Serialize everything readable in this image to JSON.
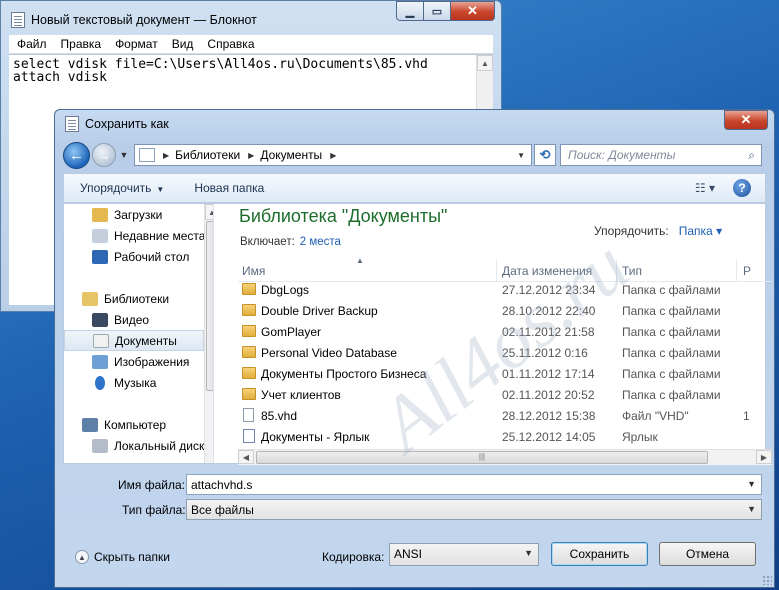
{
  "notepad": {
    "title": "Новый текстовый документ — Блокнот",
    "menu": [
      "Файл",
      "Правка",
      "Формат",
      "Вид",
      "Справка"
    ],
    "lines": [
      "select vdisk file=C:\\Users\\All4os.ru\\Documents\\85.vhd",
      "attach vdisk"
    ]
  },
  "dialog": {
    "title": "Сохранить как",
    "address": [
      "Библиотеки",
      "Документы"
    ],
    "search_placeholder": "Поиск: Документы",
    "toolbar": {
      "organize": "Упорядочить",
      "new_folder": "Новая папка"
    },
    "nav_items": [
      {
        "label": "Загрузки",
        "icon": "downloads-folder-icon"
      },
      {
        "label": "Недавние места",
        "icon": "recent-places-icon"
      },
      {
        "label": "Рабочий стол",
        "icon": "desktop-icon"
      },
      {
        "label": "Библиотеки",
        "icon": "libraries-icon"
      },
      {
        "label": "Видео",
        "icon": "video-icon"
      },
      {
        "label": "Документы",
        "icon": "documents-icon"
      },
      {
        "label": "Изображения",
        "icon": "pictures-icon"
      },
      {
        "label": "Музыка",
        "icon": "music-icon"
      },
      {
        "label": "Компьютер",
        "icon": "computer-icon"
      },
      {
        "label": "Локальный диск",
        "icon": "local-disk-icon"
      }
    ],
    "library": {
      "title": "Библиотека \"Документы\"",
      "includes_label": "Включает:",
      "includes_value": "2 места",
      "arrange_label": "Упорядочить:",
      "arrange_value": "Папка"
    },
    "columns": {
      "name": "Имя",
      "date": "Дата изменения",
      "type": "Тип",
      "size": "Р"
    },
    "files": [
      {
        "name": "DbgLogs",
        "date": "27.12.2012 23:34",
        "type": "Папка с файлами",
        "size": "",
        "kind": "folder"
      },
      {
        "name": "Double Driver Backup",
        "date": "28.10.2012 22:40",
        "type": "Папка с файлами",
        "size": "",
        "kind": "folder"
      },
      {
        "name": "GomPlayer",
        "date": "02.11.2012 21:58",
        "type": "Папка с файлами",
        "size": "",
        "kind": "folder"
      },
      {
        "name": "Personal Video Database",
        "date": "25.11.2012 0:16",
        "type": "Папка с файлами",
        "size": "",
        "kind": "folder"
      },
      {
        "name": "Документы Простого Бизнеса",
        "date": "01.11.2012 17:14",
        "type": "Папка с файлами",
        "size": "",
        "kind": "folder"
      },
      {
        "name": "Учет клиентов",
        "date": "02.11.2012 20:52",
        "type": "Папка с файлами",
        "size": "",
        "kind": "folder"
      },
      {
        "name": "85.vhd",
        "date": "28.12.2012 15:38",
        "type": "Файл \"VHD\"",
        "size": "1",
        "kind": "file"
      },
      {
        "name": "Документы - Ярлык",
        "date": "25.12.2012 14:05",
        "type": "Ярлык",
        "size": "",
        "kind": "link"
      }
    ],
    "filename_label": "Имя файла:",
    "filename_value": "attachvhd.s",
    "filetype_label": "Тип файла:",
    "filetype_value": "Все файлы",
    "hide_folders": "Скрыть папки",
    "encoding_label": "Кодировка:",
    "encoding_value": "ANSI",
    "save": "Сохранить",
    "cancel": "Отмена"
  },
  "watermark": "All4os.ru",
  "colors": {
    "library_title": "#1d6e2c",
    "link": "#1e5eb6",
    "close_button": "#c9462c"
  }
}
